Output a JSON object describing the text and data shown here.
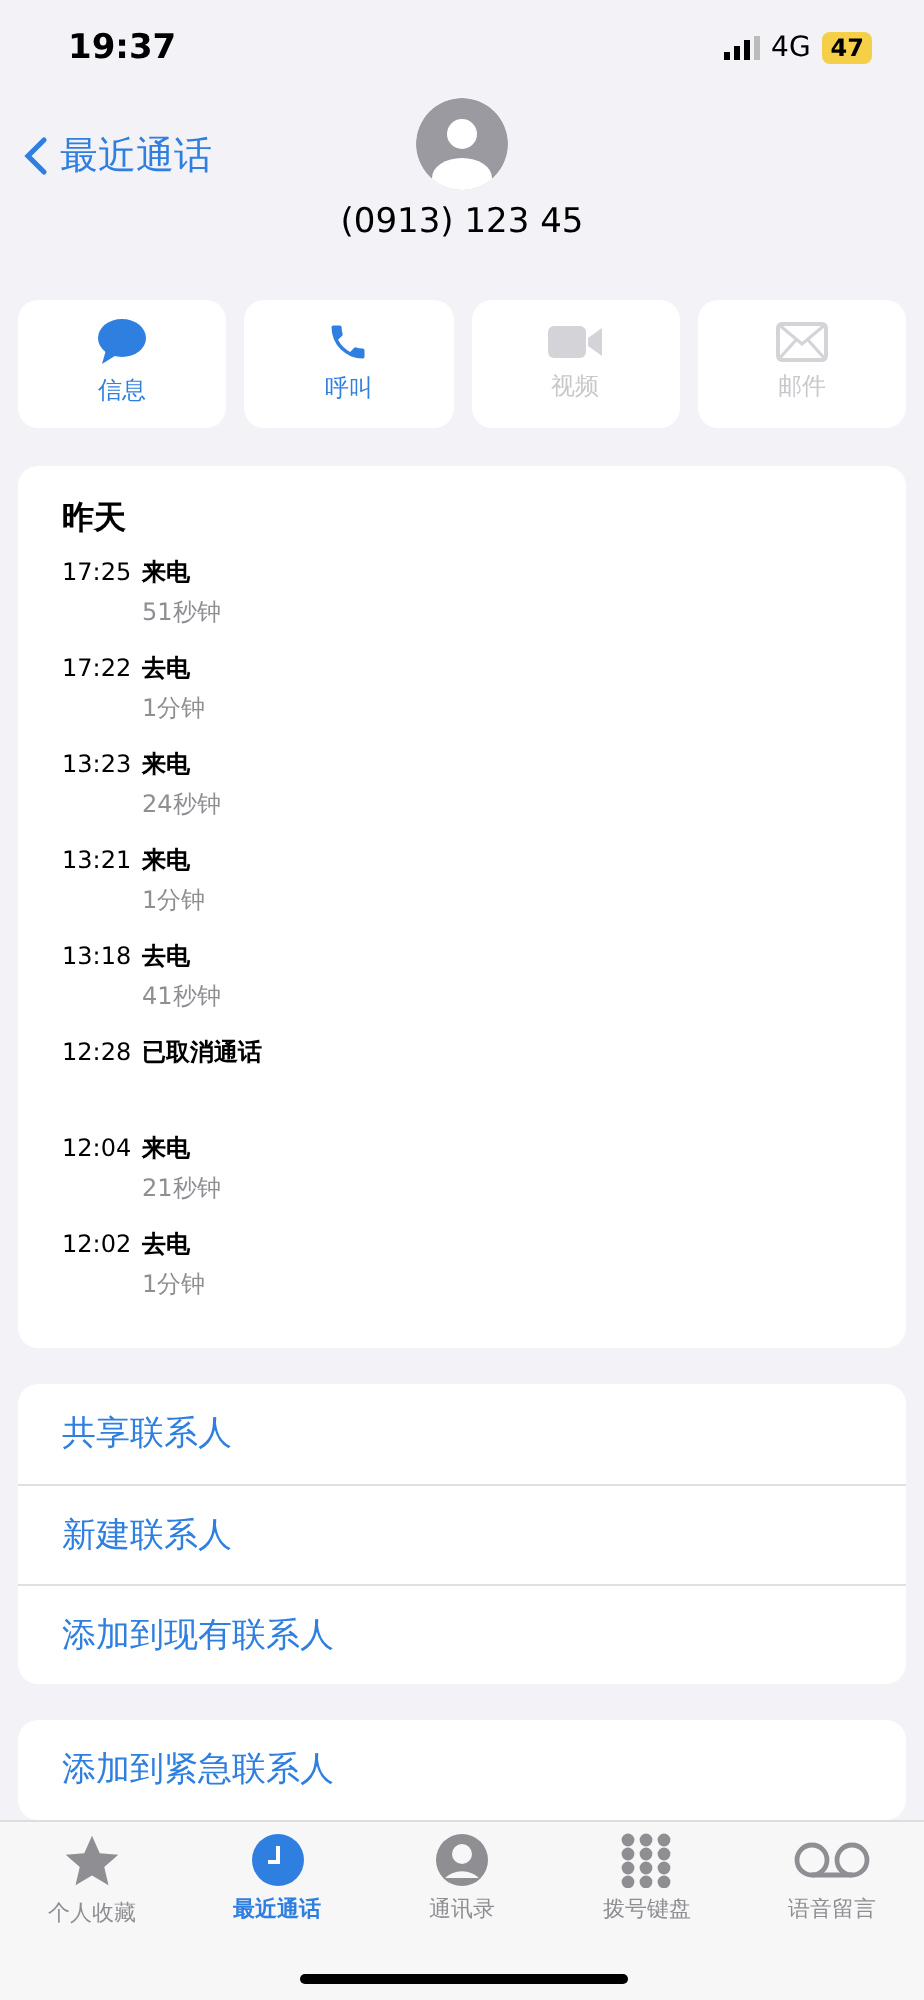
{
  "status_bar": {
    "time": "19:37",
    "network": "4G",
    "battery": "47"
  },
  "nav": {
    "back_label": "最近通话"
  },
  "contact": {
    "number": "(0913) 123 45"
  },
  "actions": [
    {
      "kind": "message",
      "label": "信息",
      "disabled": false
    },
    {
      "kind": "call",
      "label": "呼叫",
      "disabled": false
    },
    {
      "kind": "video",
      "label": "视频",
      "disabled": true
    },
    {
      "kind": "mail",
      "label": "邮件",
      "disabled": true
    }
  ],
  "history": {
    "date": "昨天",
    "calls": [
      {
        "time": "17:25",
        "type": "来电",
        "duration": "51秒钟"
      },
      {
        "time": "17:22",
        "type": "去电",
        "duration": "1分钟"
      },
      {
        "time": "13:23",
        "type": "来电",
        "duration": "24秒钟"
      },
      {
        "time": "13:21",
        "type": "来电",
        "duration": "1分钟"
      },
      {
        "time": "13:18",
        "type": "去电",
        "duration": "41秒钟"
      },
      {
        "time": "12:28",
        "type": "已取消通话"
      },
      {
        "time": "12:04",
        "type": "来电",
        "duration": "21秒钟"
      },
      {
        "time": "12:02",
        "type": "去电",
        "duration": "1分钟"
      }
    ]
  },
  "contact_options": [
    "共享联系人",
    "新建联系人",
    "添加到现有联系人"
  ],
  "emergency_option": "添加到紧急联系人",
  "tab_bar": [
    {
      "kind": "favorites",
      "label": "个人收藏",
      "selected": false
    },
    {
      "kind": "recents",
      "label": "最近通话",
      "selected": true
    },
    {
      "kind": "contacts",
      "label": "通讯录",
      "selected": false
    },
    {
      "kind": "keypad",
      "label": "拨号键盘",
      "selected": false
    },
    {
      "kind": "voicemail",
      "label": "语音留言",
      "selected": false
    }
  ]
}
